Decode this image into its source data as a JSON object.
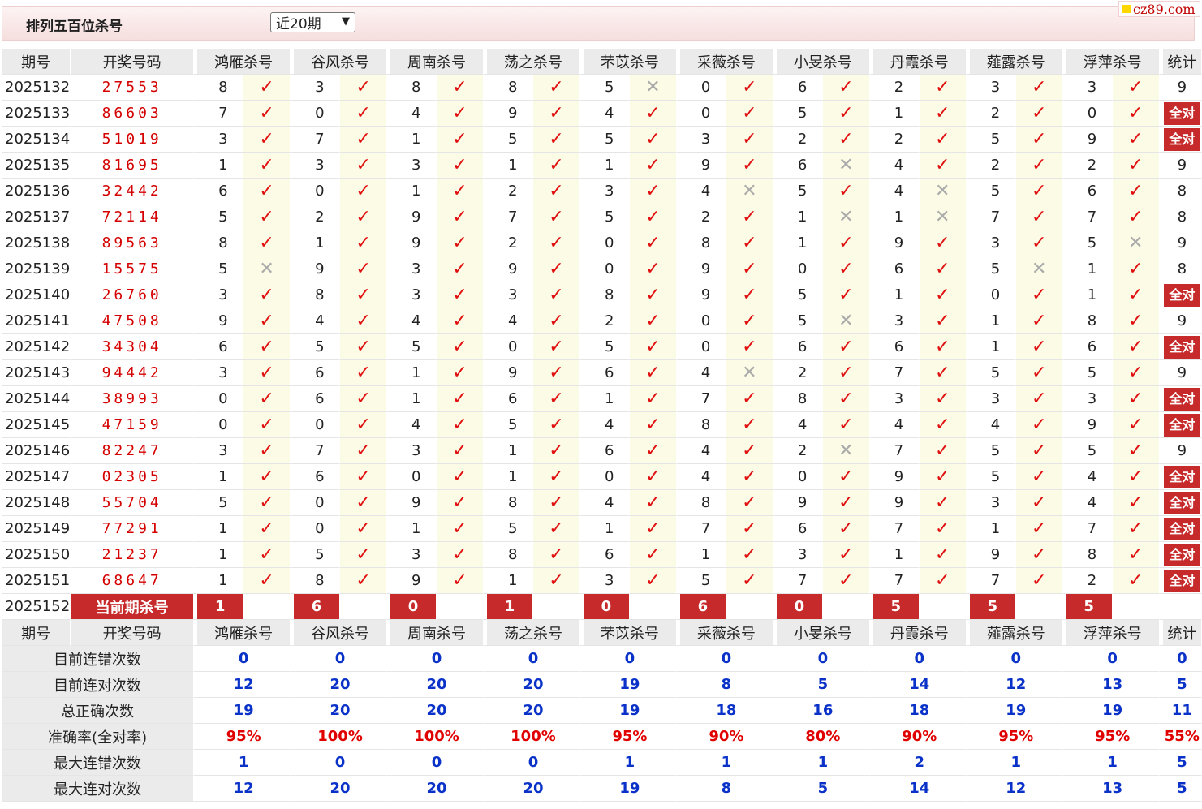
{
  "header": {
    "title": "排列五百位杀号",
    "period_select": "近20期",
    "brand": "cz89.com"
  },
  "columns": {
    "issue": "期号",
    "draw": "开奖号码",
    "stat": "统计",
    "experts": [
      "鸿雁杀号",
      "谷风杀号",
      "周南杀号",
      "荡之杀号",
      "芣苡杀号",
      "采薇杀号",
      "小旻杀号",
      "丹霞杀号",
      "薤露杀号",
      "浮萍杀号"
    ]
  },
  "rows": [
    {
      "issue": "2025132",
      "draw": "27553",
      "kills": [
        8,
        3,
        8,
        8,
        5,
        0,
        6,
        2,
        3,
        3
      ],
      "ok": [
        1,
        1,
        1,
        1,
        0,
        1,
        1,
        1,
        1,
        1
      ],
      "stat": "9"
    },
    {
      "issue": "2025133",
      "draw": "86603",
      "kills": [
        7,
        0,
        4,
        9,
        4,
        0,
        5,
        1,
        2,
        0
      ],
      "ok": [
        1,
        1,
        1,
        1,
        1,
        1,
        1,
        1,
        1,
        1
      ],
      "stat": "全对"
    },
    {
      "issue": "2025134",
      "draw": "51019",
      "kills": [
        3,
        7,
        1,
        5,
        5,
        3,
        2,
        2,
        5,
        9
      ],
      "ok": [
        1,
        1,
        1,
        1,
        1,
        1,
        1,
        1,
        1,
        1
      ],
      "stat": "全对"
    },
    {
      "issue": "2025135",
      "draw": "81695",
      "kills": [
        1,
        3,
        3,
        1,
        1,
        9,
        6,
        4,
        2,
        2
      ],
      "ok": [
        1,
        1,
        1,
        1,
        1,
        1,
        0,
        1,
        1,
        1
      ],
      "stat": "9"
    },
    {
      "issue": "2025136",
      "draw": "32442",
      "kills": [
        6,
        0,
        1,
        2,
        3,
        4,
        5,
        4,
        5,
        6
      ],
      "ok": [
        1,
        1,
        1,
        1,
        1,
        0,
        1,
        0,
        1,
        1
      ],
      "stat": "8"
    },
    {
      "issue": "2025137",
      "draw": "72114",
      "kills": [
        5,
        2,
        9,
        7,
        5,
        2,
        1,
        1,
        7,
        7
      ],
      "ok": [
        1,
        1,
        1,
        1,
        1,
        1,
        0,
        0,
        1,
        1
      ],
      "stat": "8"
    },
    {
      "issue": "2025138",
      "draw": "89563",
      "kills": [
        8,
        1,
        9,
        2,
        0,
        8,
        1,
        9,
        3,
        5
      ],
      "ok": [
        1,
        1,
        1,
        1,
        1,
        1,
        1,
        1,
        1,
        0
      ],
      "stat": "9"
    },
    {
      "issue": "2025139",
      "draw": "15575",
      "kills": [
        5,
        9,
        3,
        9,
        0,
        9,
        0,
        6,
        5,
        1
      ],
      "ok": [
        0,
        1,
        1,
        1,
        1,
        1,
        1,
        1,
        0,
        1
      ],
      "stat": "8"
    },
    {
      "issue": "2025140",
      "draw": "26760",
      "kills": [
        3,
        8,
        3,
        3,
        8,
        9,
        5,
        1,
        0,
        1
      ],
      "ok": [
        1,
        1,
        1,
        1,
        1,
        1,
        1,
        1,
        1,
        1
      ],
      "stat": "全对"
    },
    {
      "issue": "2025141",
      "draw": "47508",
      "kills": [
        9,
        4,
        4,
        4,
        2,
        0,
        5,
        3,
        1,
        8
      ],
      "ok": [
        1,
        1,
        1,
        1,
        1,
        1,
        0,
        1,
        1,
        1
      ],
      "stat": "9"
    },
    {
      "issue": "2025142",
      "draw": "34304",
      "kills": [
        6,
        5,
        5,
        0,
        5,
        0,
        6,
        6,
        1,
        6
      ],
      "ok": [
        1,
        1,
        1,
        1,
        1,
        1,
        1,
        1,
        1,
        1
      ],
      "stat": "全对"
    },
    {
      "issue": "2025143",
      "draw": "94442",
      "kills": [
        3,
        6,
        1,
        9,
        6,
        4,
        2,
        7,
        5,
        5
      ],
      "ok": [
        1,
        1,
        1,
        1,
        1,
        0,
        1,
        1,
        1,
        1
      ],
      "stat": "9"
    },
    {
      "issue": "2025144",
      "draw": "38993",
      "kills": [
        0,
        6,
        1,
        6,
        1,
        7,
        8,
        3,
        3,
        3
      ],
      "ok": [
        1,
        1,
        1,
        1,
        1,
        1,
        1,
        1,
        1,
        1
      ],
      "stat": "全对"
    },
    {
      "issue": "2025145",
      "draw": "47159",
      "kills": [
        0,
        0,
        4,
        5,
        4,
        8,
        4,
        4,
        4,
        9
      ],
      "ok": [
        1,
        1,
        1,
        1,
        1,
        1,
        1,
        1,
        1,
        1
      ],
      "stat": "全对"
    },
    {
      "issue": "2025146",
      "draw": "82247",
      "kills": [
        3,
        7,
        3,
        1,
        6,
        4,
        2,
        7,
        5,
        5
      ],
      "ok": [
        1,
        1,
        1,
        1,
        1,
        1,
        0,
        1,
        1,
        1
      ],
      "stat": "9"
    },
    {
      "issue": "2025147",
      "draw": "02305",
      "kills": [
        1,
        6,
        0,
        1,
        0,
        4,
        0,
        9,
        5,
        4
      ],
      "ok": [
        1,
        1,
        1,
        1,
        1,
        1,
        1,
        1,
        1,
        1
      ],
      "stat": "全对"
    },
    {
      "issue": "2025148",
      "draw": "55704",
      "kills": [
        5,
        0,
        9,
        8,
        4,
        8,
        9,
        9,
        3,
        4
      ],
      "ok": [
        1,
        1,
        1,
        1,
        1,
        1,
        1,
        1,
        1,
        1
      ],
      "stat": "全对"
    },
    {
      "issue": "2025149",
      "draw": "77291",
      "kills": [
        1,
        0,
        1,
        5,
        1,
        7,
        6,
        7,
        1,
        7
      ],
      "ok": [
        1,
        1,
        1,
        1,
        1,
        1,
        1,
        1,
        1,
        1
      ],
      "stat": "全对"
    },
    {
      "issue": "2025150",
      "draw": "21237",
      "kills": [
        1,
        5,
        3,
        8,
        6,
        1,
        3,
        1,
        9,
        8
      ],
      "ok": [
        1,
        1,
        1,
        1,
        1,
        1,
        1,
        1,
        1,
        1
      ],
      "stat": "全对"
    },
    {
      "issue": "2025151",
      "draw": "68647",
      "kills": [
        1,
        8,
        9,
        1,
        3,
        5,
        7,
        7,
        7,
        2
      ],
      "ok": [
        1,
        1,
        1,
        1,
        1,
        1,
        1,
        1,
        1,
        1
      ],
      "stat": "全对"
    }
  ],
  "current": {
    "issue": "2025152",
    "label": "当前期杀号",
    "kills": [
      1,
      6,
      0,
      1,
      0,
      6,
      0,
      5,
      5,
      5
    ]
  },
  "summary": [
    {
      "label": "目前连错次数",
      "values": [
        "0",
        "0",
        "0",
        "0",
        "0",
        "0",
        "0",
        "0",
        "0",
        "0",
        "0"
      ]
    },
    {
      "label": "目前连对次数",
      "values": [
        "12",
        "20",
        "20",
        "20",
        "19",
        "8",
        "5",
        "14",
        "12",
        "13",
        "5"
      ]
    },
    {
      "label": "总正确次数",
      "values": [
        "19",
        "20",
        "20",
        "20",
        "19",
        "18",
        "16",
        "18",
        "19",
        "19",
        "11"
      ]
    },
    {
      "label": "准确率(全对率)",
      "values": [
        "95%",
        "100%",
        "100%",
        "100%",
        "95%",
        "90%",
        "80%",
        "90%",
        "95%",
        "95%",
        "55%"
      ]
    },
    {
      "label": "最大连错次数",
      "values": [
        "1",
        "0",
        "0",
        "0",
        "1",
        "1",
        "1",
        "2",
        "1",
        "1",
        "5"
      ]
    },
    {
      "label": "最大连对次数",
      "values": [
        "12",
        "20",
        "20",
        "20",
        "19",
        "8",
        "5",
        "14",
        "12",
        "13",
        "5"
      ]
    }
  ],
  "marks": {
    "correct": "✓",
    "wrong": "✕"
  },
  "colors": {
    "accent": "#c62a2a",
    "draw": "#d40000",
    "value_blue": "#0a32c8",
    "rate_red": "#e00000",
    "mark_bg": "#fbfbe6",
    "header_bg": "#ebebeb"
  }
}
